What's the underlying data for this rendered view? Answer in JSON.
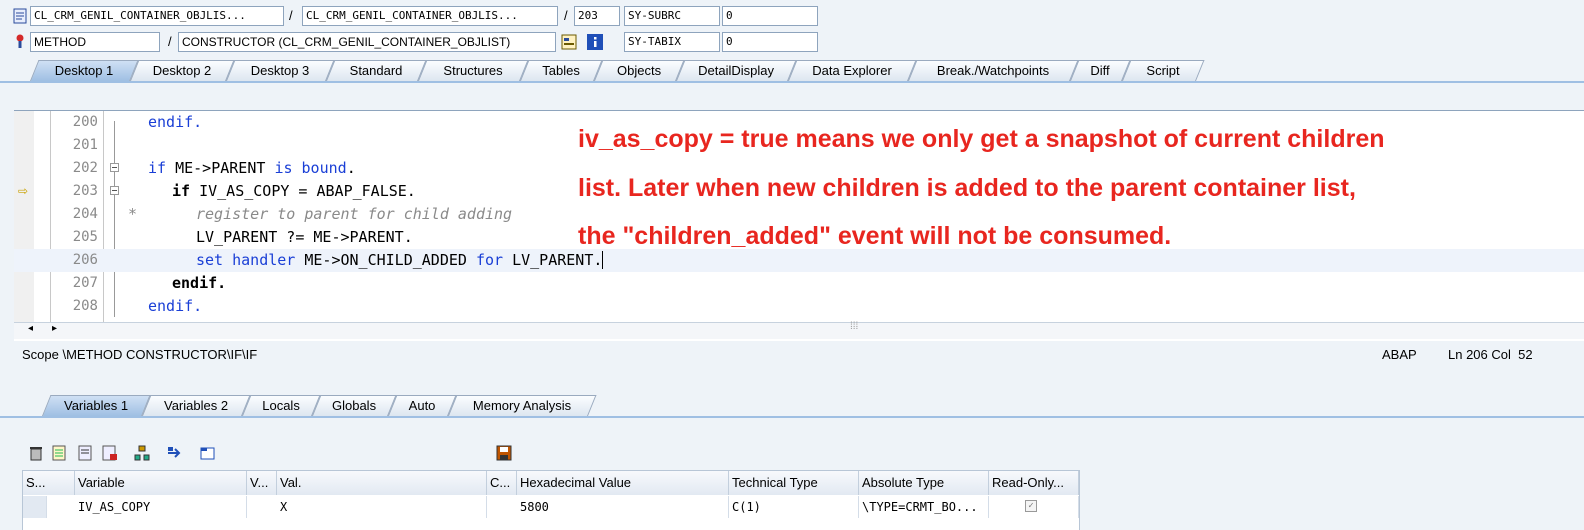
{
  "header": {
    "row1": {
      "program": "CL_CRM_GENIL_CONTAINER_OBJLIS...",
      "include": "CL_CRM_GENIL_CONTAINER_OBJLIS...",
      "line": "203",
      "sysvar": "SY-SUBRC",
      "sysval": "0"
    },
    "row2": {
      "kind": "METHOD",
      "event": "CONSTRUCTOR (CL_CRM_GENIL_CONTAINER_OBJLIST)",
      "sysvar": "SY-TABIX",
      "sysval": "0"
    },
    "slash": "/"
  },
  "tabs": [
    "Desktop 1",
    "Desktop 2",
    "Desktop 3",
    "Standard",
    "Structures",
    "Tables",
    "Objects",
    "DetailDisplay",
    "Data Explorer",
    "Break./Watchpoints",
    "Diff",
    "Script"
  ],
  "code": {
    "lines": [
      {
        "num": "200",
        "text": "endif."
      },
      {
        "num": "201",
        "text": ""
      },
      {
        "num": "202",
        "text": "if ME->PARENT is bound."
      },
      {
        "num": "203",
        "text": "if IV_AS_COPY = ABAP_FALSE."
      },
      {
        "num": "204",
        "text": "register to parent for child adding"
      },
      {
        "num": "205",
        "text": "LV_PARENT ?= ME->PARENT."
      },
      {
        "num": "206",
        "text": "set handler ME->ON_CHILD_ADDED for LV_PARENT."
      },
      {
        "num": "207",
        "text": "endif."
      },
      {
        "num": "208",
        "text": "endif."
      }
    ],
    "comment_star": "*"
  },
  "annotation": {
    "line1": "iv_as_copy = true means we only get a snapshot of current children",
    "line2": "list. Later when new children is added to the parent container list,",
    "line3": "the \"children_added\" event will not be consumed."
  },
  "status": {
    "scope": "Scope \\METHOD CONSTRUCTOR\\IF\\IF",
    "lang": "ABAP",
    "position": "Ln 206 Col  52"
  },
  "var_tabs": [
    "Variables 1",
    "Variables 2",
    "Locals",
    "Globals",
    "Auto",
    "Memory Analysis"
  ],
  "table": {
    "columns": [
      "S...",
      "Variable",
      "V...",
      "Val.",
      "C...",
      "Hexadecimal Value",
      "Technical Type",
      "Absolute Type",
      "Read-Only..."
    ],
    "rows": [
      {
        "variable": "IV_AS_COPY",
        "value": "X",
        "hex": "5800",
        "tech": "C(1)",
        "abs": "\\TYPE=CRMT_BO..."
      }
    ]
  },
  "colors": {
    "accent": "#9fbfe3",
    "annotation": "#e8261f",
    "keyword": "#1a3fd6"
  }
}
